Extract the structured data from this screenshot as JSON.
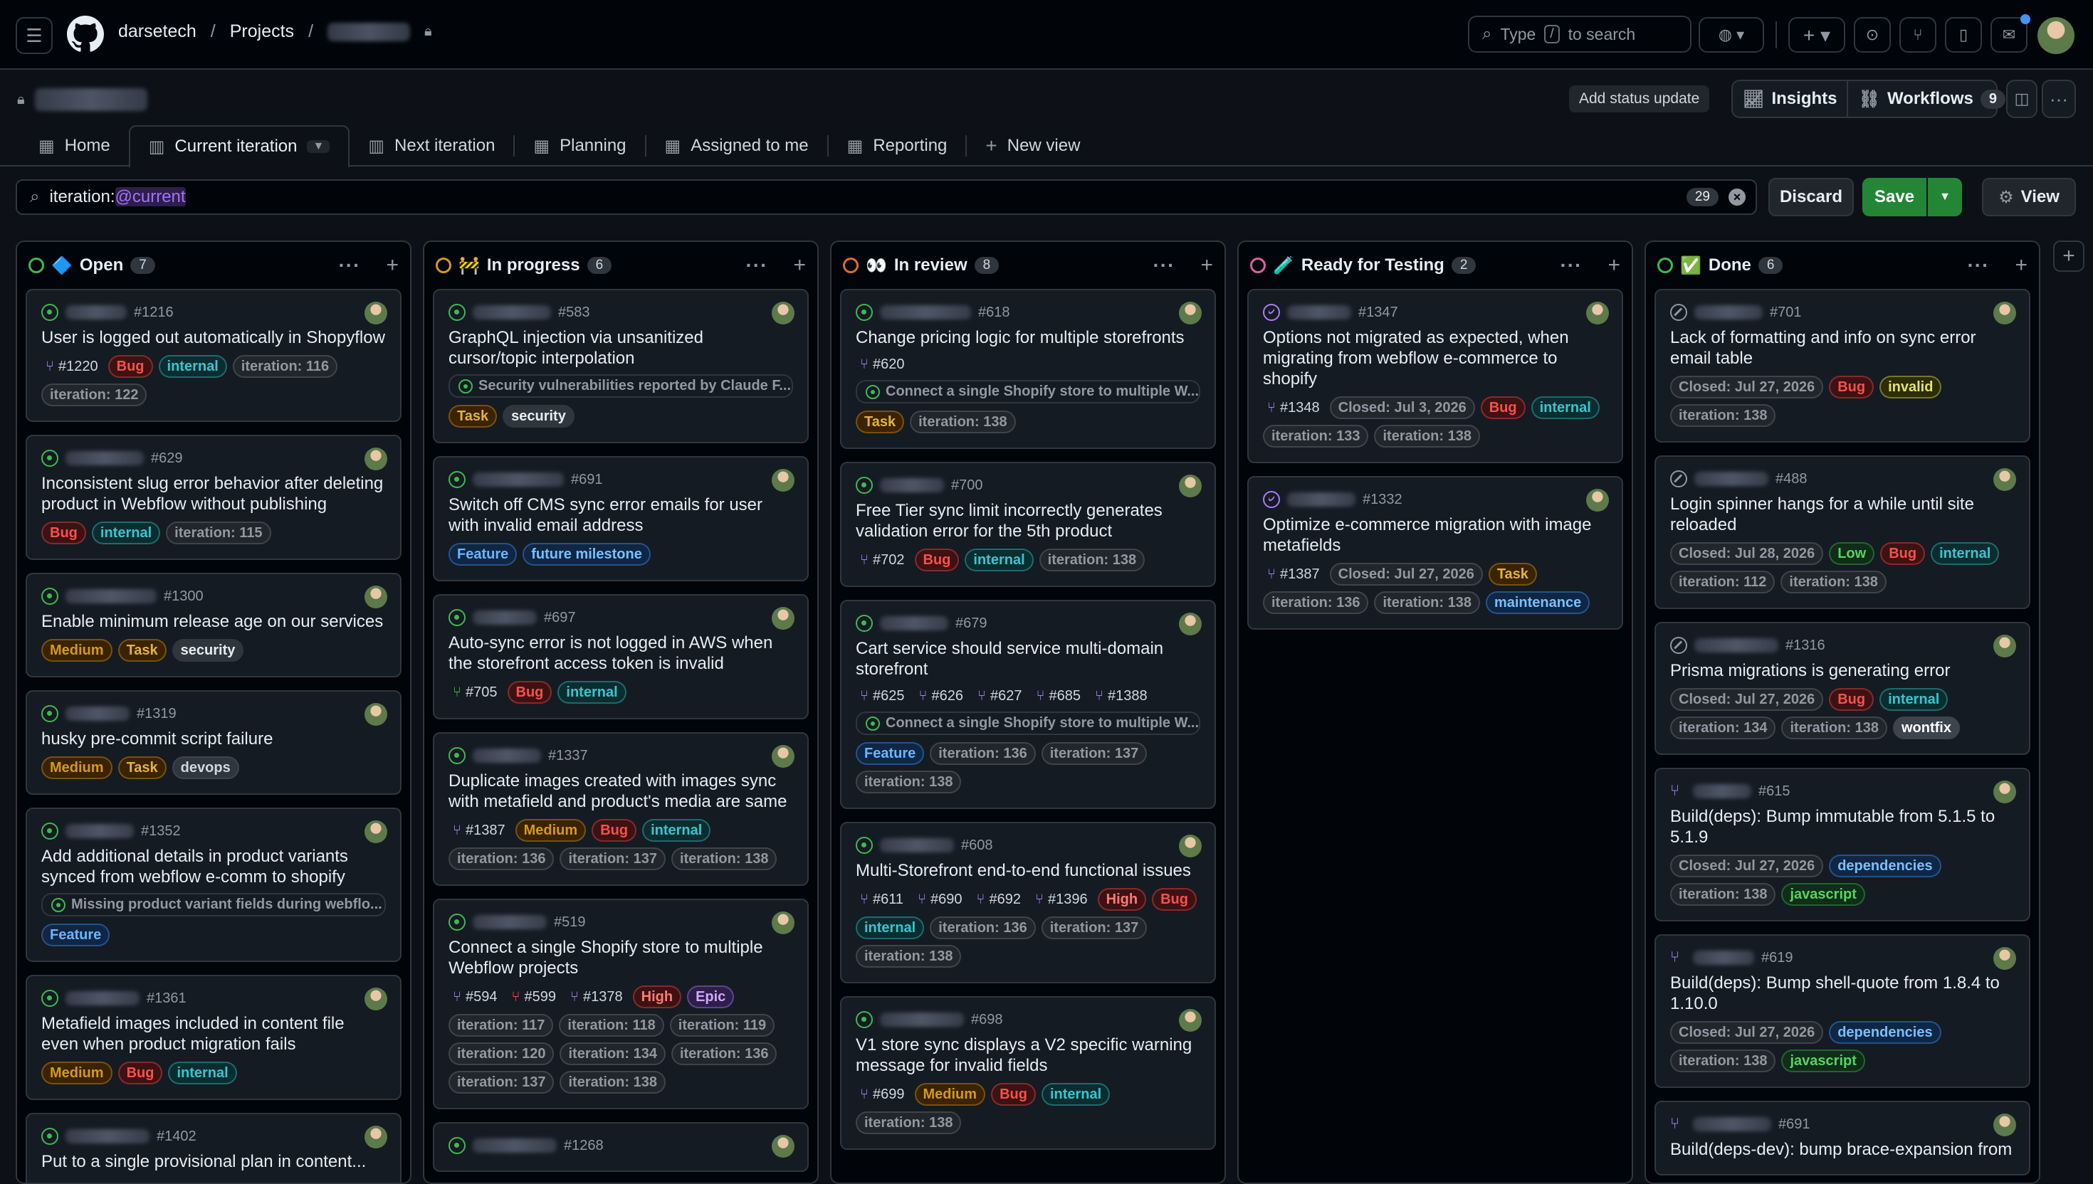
{
  "header": {
    "org": "darsetech",
    "projects": "Projects",
    "search_placeholder_pre": "Type",
    "search_key": "/",
    "search_placeholder_post": "to search"
  },
  "project": {
    "add_status": "Add status update",
    "insights": "Insights",
    "workflows": "Workflows",
    "workflows_count": "9"
  },
  "tabs": [
    {
      "label": "Home"
    },
    {
      "label": "Current iteration"
    },
    {
      "label": "Next iteration"
    },
    {
      "label": "Planning"
    },
    {
      "label": "Assigned to me"
    },
    {
      "label": "Reporting"
    },
    {
      "label": "New view"
    }
  ],
  "filter": {
    "prefix": "iteration:",
    "token": "@current",
    "count": "29",
    "discard": "Discard",
    "save": "Save",
    "view": "View"
  },
  "colors": {
    "bug": "#f85149",
    "internal": "#39c5cf",
    "feature": "#4493f8",
    "medium": "#d29922",
    "green": "#3fb950",
    "purple": "#ab7df8"
  },
  "columns": [
    {
      "title": "Open",
      "emoji": "🔷",
      "count": "7",
      "ring": "#3fb950",
      "cards": [
        {
          "num": "#1216",
          "title": "User is logged out automatically in Shopyflow",
          "refs": [
            "#1220"
          ],
          "labels": [
            "Bug",
            "internal",
            "iteration: 116",
            "iteration: 122"
          ]
        },
        {
          "num": "#629",
          "title": "Inconsistent slug error behavior after deleting product in Webflow without publishing",
          "labels": [
            "Bug",
            "internal",
            "iteration: 115"
          ]
        },
        {
          "num": "#1300",
          "title": "Enable minimum release age on our services",
          "labels": [
            "Medium",
            "Task",
            "security"
          ]
        },
        {
          "num": "#1319",
          "title": "husky pre-commit script failure",
          "labels": [
            "Medium",
            "Task",
            "devops"
          ]
        },
        {
          "num": "#1352",
          "title": "Add additional details in product variants synced from webflow e-comm to shopify",
          "parent": "Missing product variant fields during webflo...",
          "labels": [
            "Feature"
          ]
        },
        {
          "num": "#1361",
          "title": "Metafield images included in content file even when product migration fails",
          "labels": [
            "Medium",
            "Bug",
            "internal"
          ]
        },
        {
          "num": "#1402",
          "title": "Put to a single provisional plan in content..."
        }
      ]
    },
    {
      "title": "In progress",
      "emoji": "🚧",
      "count": "6",
      "ring": "#d29922",
      "cards": [
        {
          "num": "#583",
          "title": "GraphQL injection via unsanitized cursor/topic interpolation",
          "parent": "Security vulnerabilities reported by Claude F...",
          "labels": [
            "Task",
            "security"
          ]
        },
        {
          "num": "#691",
          "title": "Switch off CMS sync error emails for user with invalid email address",
          "labels": [
            "Feature",
            "future milestone"
          ]
        },
        {
          "num": "#697",
          "title": "Auto-sync error is not logged in AWS when the storefront access token is invalid",
          "refs": [
            "#705"
          ],
          "labels": [
            "Bug",
            "internal"
          ]
        },
        {
          "num": "#1337",
          "title": "Duplicate images created with images sync with metafield and product's media are same",
          "refs": [
            "#1387"
          ],
          "labels": [
            "Medium",
            "Bug",
            "internal",
            "iteration: 136",
            "iteration: 137",
            "iteration: 138"
          ]
        },
        {
          "num": "#519",
          "title": "Connect a single Shopify store to multiple Webflow projects",
          "refs": [
            "#594",
            "#599",
            "#1378"
          ],
          "labels": [
            "High",
            "Epic",
            "iteration: 117",
            "iteration: 118",
            "iteration: 119",
            "iteration: 120",
            "iteration: 134",
            "iteration: 136",
            "iteration: 137",
            "iteration: 138"
          ]
        },
        {
          "num": "#1268",
          "title": ""
        }
      ]
    },
    {
      "title": "In review",
      "emoji": "👀",
      "count": "8",
      "ring": "#db6d28",
      "cards": [
        {
          "num": "#618",
          "title": "Change pricing logic for multiple storefronts",
          "refs": [
            "#620"
          ],
          "parent": "Connect a single Shopify store to multiple W...",
          "labels": [
            "Task",
            "iteration: 138"
          ]
        },
        {
          "num": "#700",
          "title": "Free Tier sync limit incorrectly generates validation error for the 5th product",
          "refs": [
            "#702"
          ],
          "labels": [
            "Bug",
            "internal",
            "iteration: 138"
          ]
        },
        {
          "num": "#679",
          "title": "Cart service should service multi-domain storefront",
          "refs": [
            "#625",
            "#626",
            "#627",
            "#685",
            "#1388"
          ],
          "parent": "Connect a single Shopify store to multiple W...",
          "labels": [
            "Feature",
            "iteration: 136",
            "iteration: 137",
            "iteration: 138"
          ]
        },
        {
          "num": "#608",
          "title": "Multi-Storefront end-to-end functional issues",
          "refs": [
            "#611",
            "#690",
            "#692",
            "#1396"
          ],
          "labels": [
            "High",
            "Bug",
            "internal",
            "iteration: 136",
            "iteration: 137",
            "iteration: 138"
          ]
        },
        {
          "num": "#698",
          "title": "V1 store sync displays a V2 specific warning message for invalid fields",
          "refs": [
            "#699"
          ],
          "labels": [
            "Medium",
            "Bug",
            "internal",
            "iteration: 138"
          ]
        }
      ]
    },
    {
      "title": "Ready for Testing",
      "emoji": "🧪",
      "count": "2",
      "ring": "#db61a2",
      "cards": [
        {
          "num": "#1347",
          "title": "Options not migrated as expected, when migrating from webflow e-commerce to shopify",
          "refs": [
            "#1348"
          ],
          "labels": [
            "Closed: Jul 3, 2026",
            "Bug",
            "internal",
            "iteration: 133",
            "iteration: 138"
          ]
        },
        {
          "num": "#1332",
          "title": "Optimize e-commerce migration with image metafields",
          "refs": [
            "#1387"
          ],
          "labels": [
            "Closed: Jul 27, 2026",
            "Task",
            "iteration: 136",
            "iteration: 138",
            "maintenance"
          ]
        }
      ]
    },
    {
      "title": "Done",
      "emoji": "✅",
      "count": "6",
      "ring": "#3fb950",
      "cards": [
        {
          "num": "#701",
          "title": "Lack of formatting and info on sync error email table",
          "labels": [
            "Closed: Jul 27, 2026",
            "Bug",
            "invalid",
            "iteration: 138"
          ]
        },
        {
          "num": "#488",
          "title": "Login spinner hangs for a while until site reloaded",
          "labels": [
            "Closed: Jul 28, 2026",
            "Low",
            "Bug",
            "internal",
            "iteration: 112",
            "iteration: 138"
          ]
        },
        {
          "num": "#1316",
          "title": "Prisma migrations is generating error",
          "labels": [
            "Closed: Jul 27, 2026",
            "Bug",
            "internal",
            "iteration: 134",
            "iteration: 138",
            "wontfix"
          ]
        },
        {
          "num": "#615",
          "title": "Build(deps): Bump immutable from 5.1.5 to 5.1.9",
          "labels": [
            "Closed: Jul 27, 2026",
            "dependencies",
            "iteration: 138",
            "javascript"
          ]
        },
        {
          "num": "#619",
          "title": "Build(deps): Bump shell-quote from 1.8.4 to 1.10.0",
          "labels": [
            "Closed: Jul 27, 2026",
            "dependencies",
            "iteration: 138",
            "javascript"
          ]
        },
        {
          "num": "#691",
          "title": "Build(deps-dev): bump brace-expansion from"
        }
      ]
    }
  ]
}
